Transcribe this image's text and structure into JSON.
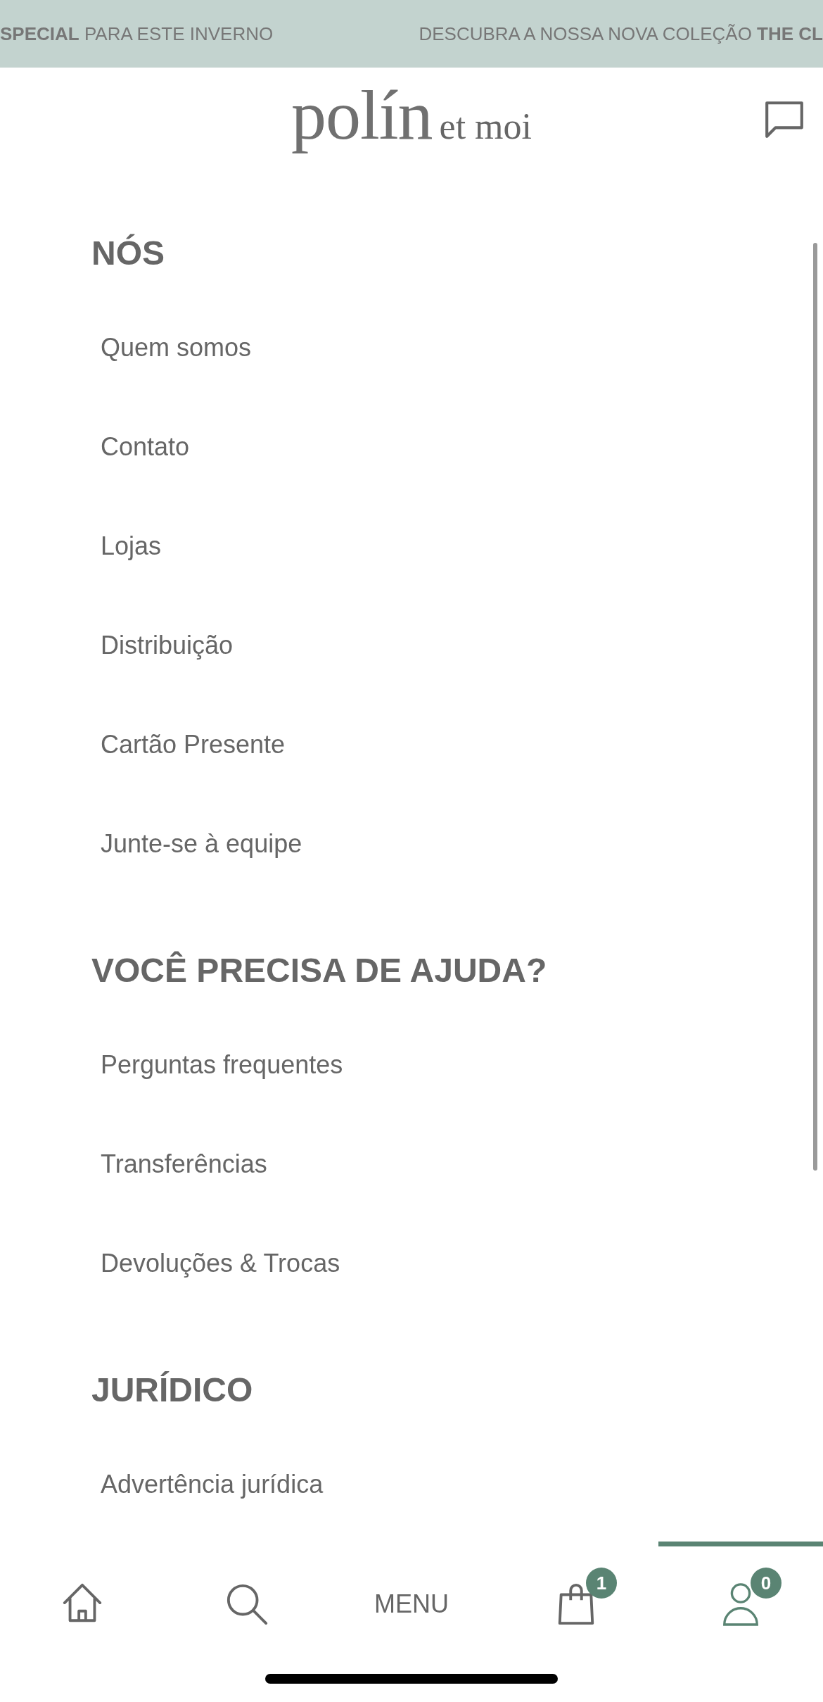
{
  "announcement_bar": {
    "messages": [
      "**SPECIAL** PARA ESTE INVERNO",
      "DESCUBRA A NOSSA NOVA COLEÇÃO **THE CL**"
    ]
  },
  "header": {
    "logo": {
      "name": "polín",
      "suffix": "et moi"
    }
  },
  "menu": {
    "sections": [
      {
        "title": "NÓS",
        "items": [
          "Quem somos",
          "Contato",
          "Lojas",
          "Distribuição",
          "Cartão Presente",
          "Junte-se à equipe"
        ]
      },
      {
        "title": "VOCÊ PRECISA DE AJUDA?",
        "items": [
          "Perguntas frequentes",
          "Transferências",
          "Devoluções & Trocas"
        ]
      },
      {
        "title": "JURÍDICO",
        "items": [
          "Advertência jurídica"
        ]
      }
    ]
  },
  "bottom_nav": [
    {
      "kind": "home",
      "selected": false
    },
    {
      "kind": "search",
      "selected": false
    },
    {
      "kind": "text",
      "label": "MENU",
      "selected": false
    },
    {
      "kind": "bag",
      "badge": "1",
      "selected": false
    },
    {
      "kind": "account",
      "badge": "0",
      "selected": true
    }
  ]
}
